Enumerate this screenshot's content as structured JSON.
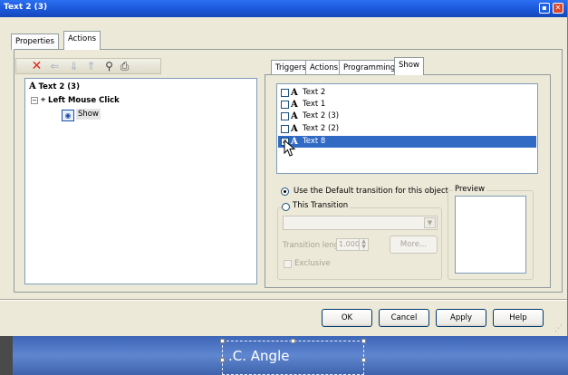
{
  "window": {
    "title": "Text 2 (3)"
  },
  "main_tabs": [
    {
      "label": "Properties"
    },
    {
      "label": "Actions",
      "selected": true
    }
  ],
  "toolbar": {
    "icons": [
      "delete-icon",
      "arrow-left-icon",
      "arrow-down-icon",
      "arrow-up-icon",
      "tree-icon",
      "print-icon"
    ]
  },
  "tree": {
    "root": "Text 2 (3)",
    "trigger": "Left Mouse Click",
    "action": "Show"
  },
  "right_tabs": [
    {
      "label": "Triggers"
    },
    {
      "label": "Actions"
    },
    {
      "label": "Programming"
    },
    {
      "label": "Show",
      "selected": true
    }
  ],
  "objects": [
    {
      "label": "Text 2",
      "checked": false,
      "selected": false
    },
    {
      "label": "Text 1",
      "checked": false,
      "selected": false
    },
    {
      "label": "Text 2 (3)",
      "checked": false,
      "selected": false
    },
    {
      "label": "Text 2 (2)",
      "checked": false,
      "selected": false
    },
    {
      "label": "Text 8",
      "checked": true,
      "selected": true
    }
  ],
  "transition": {
    "default_label": "Use the Default transition for this object",
    "this_label": "This Transition",
    "length_label": "Transition length",
    "length_value": "1.000",
    "more_label": "More...",
    "exclusive_label": "Exclusive",
    "preview_label": "Preview"
  },
  "buttons": {
    "ok": "OK",
    "cancel": "Cancel",
    "apply": "Apply",
    "help": "Help"
  },
  "slide": {
    "text": ".C. Angle"
  },
  "colors": {
    "title_bar": "#1a55d6",
    "selection": "#316ac5",
    "slide_bg": "#4a6fb0"
  }
}
